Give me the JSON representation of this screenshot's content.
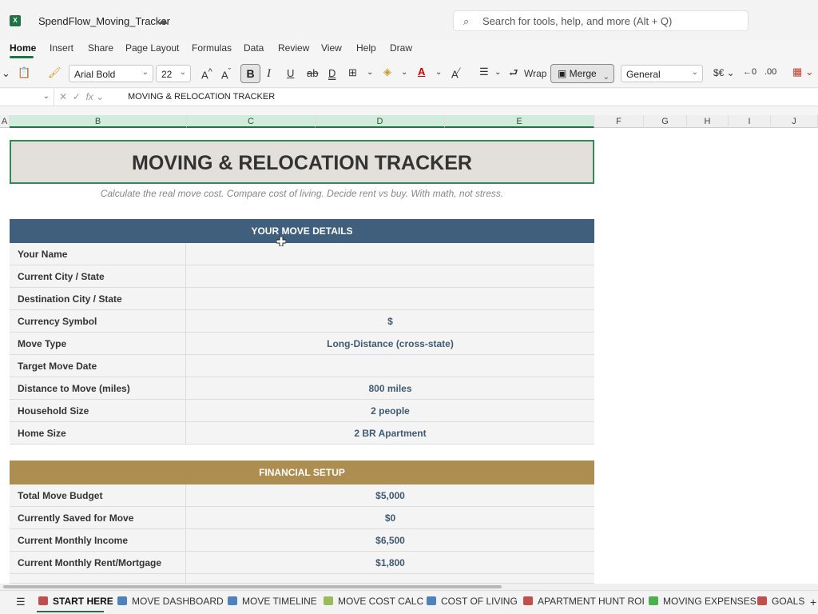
{
  "app": {
    "title": "SpendFlow_Moving_Tracker",
    "icon": "excel-icon"
  },
  "search": {
    "placeholder": "Search for tools, help, and more (Alt + Q)"
  },
  "menu": [
    {
      "label": "Home",
      "active": true
    },
    {
      "label": "Insert"
    },
    {
      "label": "Share"
    },
    {
      "label": "Page Layout"
    },
    {
      "label": "Formulas"
    },
    {
      "label": "Data"
    },
    {
      "label": "Review"
    },
    {
      "label": "View"
    },
    {
      "label": "Help"
    },
    {
      "label": "Draw"
    }
  ],
  "ribbon": {
    "font": "Arial Bold",
    "size": "22",
    "wrap": "Wrap",
    "merge": "Merge",
    "number_format": "General"
  },
  "formula": {
    "content": "MOVING & RELOCATION TRACKER"
  },
  "columns": [
    "A",
    "B",
    "C",
    "D",
    "E",
    "F",
    "G",
    "H",
    "I",
    "J"
  ],
  "sheet": {
    "title": "MOVING & RELOCATION TRACKER",
    "subtitle": "Calculate the real move cost. Compare cost of living. Decide rent vs buy. With math, not stress.",
    "sections": [
      {
        "header": "YOUR MOVE DETAILS",
        "color": "#3f5f7c",
        "rows": [
          {
            "label": "Your Name",
            "value": ""
          },
          {
            "label": "Current City / State",
            "value": ""
          },
          {
            "label": "Destination City / State",
            "value": ""
          },
          {
            "label": "Currency Symbol",
            "value": "$"
          },
          {
            "label": "Move Type",
            "value": "Long-Distance (cross-state)"
          },
          {
            "label": "Target Move Date",
            "value": ""
          },
          {
            "label": "Distance to Move (miles)",
            "value": "800 miles"
          },
          {
            "label": "Household Size",
            "value": "2 people"
          },
          {
            "label": "Home Size",
            "value": "2 BR Apartment"
          }
        ]
      },
      {
        "header": "FINANCIAL SETUP",
        "color": "#ad8e50",
        "rows": [
          {
            "label": "Total Move Budget",
            "value": "$5,000"
          },
          {
            "label": "Currently Saved for Move",
            "value": "$0"
          },
          {
            "label": "Current Monthly Income",
            "value": "$6,500"
          },
          {
            "label": "Current Monthly Rent/Mortgage",
            "value": "$1,800"
          }
        ]
      }
    ]
  },
  "tabs": [
    {
      "label": "START HERE",
      "icon": "home-icon",
      "color": "#c0504d",
      "active": true
    },
    {
      "label": "MOVE DASHBOARD",
      "icon": "chart-icon",
      "color": "#4f81bd"
    },
    {
      "label": "MOVE TIMELINE",
      "icon": "calendar-icon",
      "color": "#4f81bd"
    },
    {
      "label": "MOVE COST CALC",
      "icon": "truck-icon",
      "color": "#9bbb59"
    },
    {
      "label": "COST OF LIVING",
      "icon": "city-icon",
      "color": "#4f81bd"
    },
    {
      "label": "APARTMENT HUNT ROI",
      "icon": "building-icon",
      "color": "#c0504d"
    },
    {
      "label": "MOVING EXPENSES",
      "icon": "money-icon",
      "color": "#4caf50"
    },
    {
      "label": "GOALS",
      "icon": "target-icon",
      "color": "#c0504d"
    }
  ]
}
